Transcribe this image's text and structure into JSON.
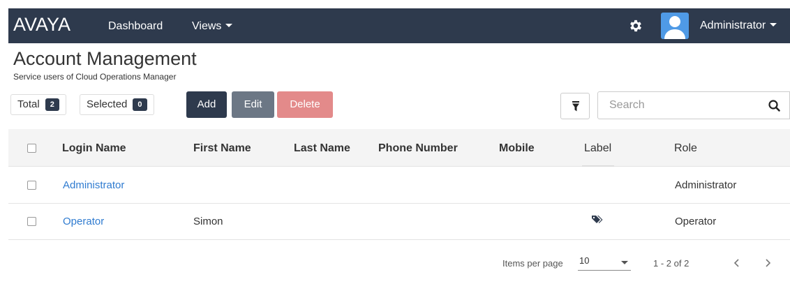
{
  "nav": {
    "logo": "AVAYA",
    "dashboard": "Dashboard",
    "views": "Views",
    "user": "Administrator"
  },
  "header": {
    "title": "Account Management",
    "subtitle": "Service users of Cloud Operations Manager"
  },
  "counters": {
    "total_label": "Total",
    "total_value": "2",
    "selected_label": "Selected",
    "selected_value": "0"
  },
  "actions": {
    "add": "Add",
    "edit": "Edit",
    "delete": "Delete"
  },
  "search": {
    "placeholder": "Search"
  },
  "table": {
    "columns": [
      "Login Name",
      "First Name",
      "Last Name",
      "Phone Number",
      "Mobile",
      "Label",
      "Role"
    ],
    "rows": [
      {
        "login": "Administrator",
        "first": "",
        "last": "",
        "phone": "",
        "mobile": "",
        "has_label": false,
        "role": "Administrator"
      },
      {
        "login": "Operator",
        "first": "Simon",
        "last": "",
        "phone": "",
        "mobile": "",
        "has_label": true,
        "role": "Operator"
      }
    ]
  },
  "pagination": {
    "items_per_page_label": "Items per page",
    "items_per_page": "10",
    "range": "1 - 2 of 2"
  },
  "icons": {
    "gear": "gear-icon",
    "avatar": "user-avatar-icon",
    "filter": "filter-icon",
    "search": "search-icon",
    "tag": "tags-icon",
    "prev": "chevron-left-icon",
    "next": "chevron-right-icon"
  },
  "colors": {
    "nav_bg": "#2e3a4d",
    "link": "#2f7bd0",
    "add_btn": "#2e3a4d",
    "edit_btn": "#6c7785",
    "delete_btn": "#e38a8a"
  }
}
